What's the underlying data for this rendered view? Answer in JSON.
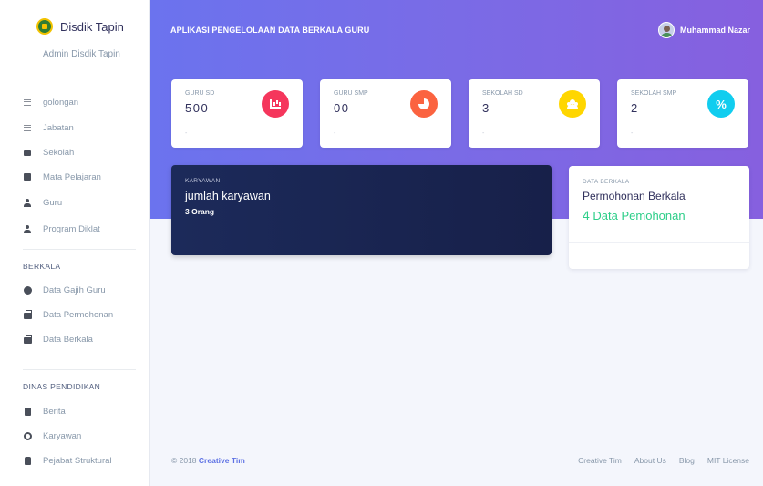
{
  "brand": {
    "title": "Disdik Tapin",
    "subtitle": "Admin Disdik Tapin"
  },
  "sidebar": {
    "items": [
      {
        "label": "golongan",
        "icon": "list-icon"
      },
      {
        "label": "Jabatan",
        "icon": "list-icon"
      },
      {
        "label": "Sekolah",
        "icon": "school-icon"
      },
      {
        "label": "Mata Pelajaran",
        "icon": "book-icon"
      },
      {
        "label": "Guru",
        "icon": "person-icon"
      },
      {
        "label": "Program Diklat",
        "icon": "person-icon"
      }
    ],
    "section_berkala": "BERKALA",
    "berkala_items": [
      {
        "label": "Data Gajih Guru",
        "icon": "circle-icon"
      },
      {
        "label": "Data Permohonan",
        "icon": "briefcase-icon"
      },
      {
        "label": "Data Berkala",
        "icon": "briefcase-icon"
      }
    ],
    "section_dinas": "DINAS PENDIDIKAN",
    "dinas_items": [
      {
        "label": "Berita",
        "icon": "news-icon"
      },
      {
        "label": "Karyawan",
        "icon": "user-circle-icon"
      },
      {
        "label": "Pejabat Struktural",
        "icon": "hand-icon"
      }
    ]
  },
  "header": {
    "title": "APLIKASI PENGELOLAAN DATA BERKALA GURU",
    "user_name": "Muhammad Nazar"
  },
  "stats": [
    {
      "label": "GURU SD",
      "value": "500",
      "icon": "bar-chart-icon",
      "color": "#f5365c",
      "foot": "-"
    },
    {
      "label": "GURU SMP",
      "value": "00",
      "icon": "pie-chart-icon",
      "color": "#fb6340",
      "foot": "-"
    },
    {
      "label": "SEKOLAH SD",
      "value": "3",
      "icon": "users-icon",
      "color": "#ffd600",
      "foot": "-"
    },
    {
      "label": "SEKOLAH SMP",
      "value": "2",
      "icon": "percent-icon",
      "color": "#11cdef",
      "foot": "-"
    }
  ],
  "karyawan_card": {
    "label": "KARYAWAN",
    "title": "jumlah karyawan",
    "sub": "3 Orang"
  },
  "berkala_card": {
    "label": "DATA BERKALA",
    "title": "Permohonan Berkala",
    "number": "4",
    "text": "Data Pemohonan"
  },
  "footer": {
    "copy": "© 2018",
    "copy_link": "Creative Tim",
    "links": [
      "Creative Tim",
      "About Us",
      "Blog",
      "MIT License"
    ]
  },
  "colors": {
    "accent": "#5e72e4",
    "success": "#2dce89",
    "dark_card": "#1c2a5a"
  }
}
